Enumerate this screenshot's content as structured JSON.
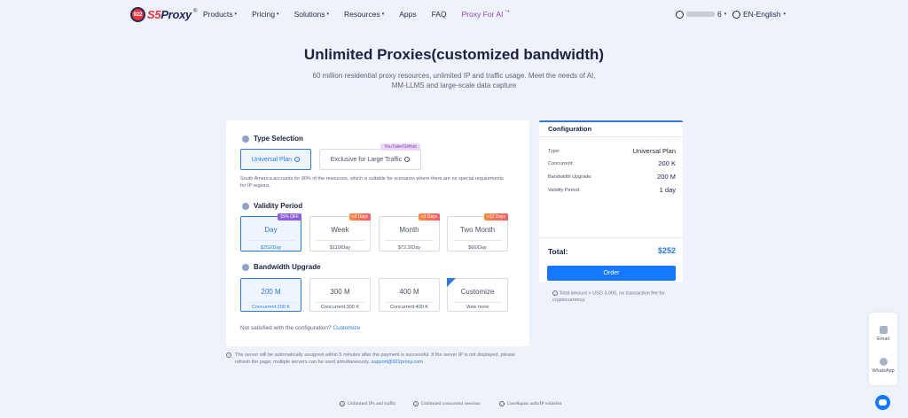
{
  "nav": {
    "logo_badge": "922",
    "logo_s": "S5",
    "logo_rest": "Proxy",
    "logo_reg": "®",
    "menu": [
      {
        "label": "Products",
        "caret": "▾"
      },
      {
        "label": "Pricing",
        "caret": "▾"
      },
      {
        "label": "Solutions",
        "caret": "▾"
      },
      {
        "label": "Resources",
        "caret": "▾"
      },
      {
        "label": "Apps",
        "caret": ""
      },
      {
        "label": "FAQ",
        "caret": ""
      },
      {
        "label": "Proxy For AI",
        "caret": ""
      }
    ],
    "user_suffix": "6",
    "caret": "▾",
    "lang": "EN-English"
  },
  "hero": {
    "title": "Unlimited Proxies(customized bandwidth)",
    "subtitle": "60 million residential proxy resources, unlimited IP and traffic usage. Meet the needs of AI, MM-LLMS and large-scale data capture"
  },
  "type_selection": {
    "title": "Type Selection",
    "options": [
      {
        "label": "Universal Plan",
        "selected": true
      },
      {
        "label": "Exclusive for Large Traffic",
        "tag": "YouTube/GitHub",
        "selected": false
      }
    ],
    "description": "South America accounts for 90% of the resources, which is suitable for scenarios where there are no special requirements for IP regions."
  },
  "validity": {
    "title": "Validity Period",
    "options": [
      {
        "name": "Day",
        "price": "$252/Day",
        "badge": "15% OFF",
        "selected": true
      },
      {
        "name": "Week",
        "price": "$110/Day",
        "badge": "+2 Days",
        "selected": false
      },
      {
        "name": "Month",
        "price": "$72.3/Day",
        "badge": "+3 Days",
        "selected": false
      },
      {
        "name": "Two Month",
        "price": "$66/Day",
        "badge": "+12 Days",
        "selected": false
      }
    ]
  },
  "bandwidth": {
    "title": "Bandwidth Upgrade",
    "options": [
      {
        "name": "200 M",
        "sub": "Concurrent:200 K",
        "selected": true
      },
      {
        "name": "300 M",
        "sub": "Concurrent:300 K",
        "selected": false
      },
      {
        "name": "400 M",
        "sub": "Concurrent:400 K",
        "selected": false
      },
      {
        "name": "Customize",
        "sub": "View more",
        "selected": false
      }
    ],
    "footer_text": "Not satisfied with the configuration?",
    "footer_link": "Customize"
  },
  "note": {
    "text": "The server will be automatically assigned within 5 minutes after the payment is successful. If the server IP is not displayed, please refresh the page; multiple servers can be used simultaneously.",
    "email": "support@922proxy.com"
  },
  "config": {
    "title": "Configuration",
    "rows": [
      {
        "k": "Type:",
        "v": "Universal Plan"
      },
      {
        "k": "Concurrent:",
        "v": "200 K"
      },
      {
        "k": "Bandwidth Upgrade:",
        "v": "200 M"
      },
      {
        "k": "Validity Period:",
        "v": "1 day"
      }
    ],
    "total_label": "Total:",
    "total_value": "$252",
    "order_label": "Order",
    "note": "Total amount > USD 3,000, no transaction fee for cryptocurrency."
  },
  "features": [
    "Unlimited IPs and traffic",
    "Unlimited concurrent sessions",
    "User&pass auth/IP whitelist"
  ],
  "widget": {
    "email": "Email",
    "whatsapp": "WhatsApp"
  },
  "symbols": {
    "info": "i",
    "check": "✓"
  },
  "colors": {
    "primary": "#1677ff",
    "accent": "#8e44ad",
    "selected_border": "#2b7bd8"
  }
}
